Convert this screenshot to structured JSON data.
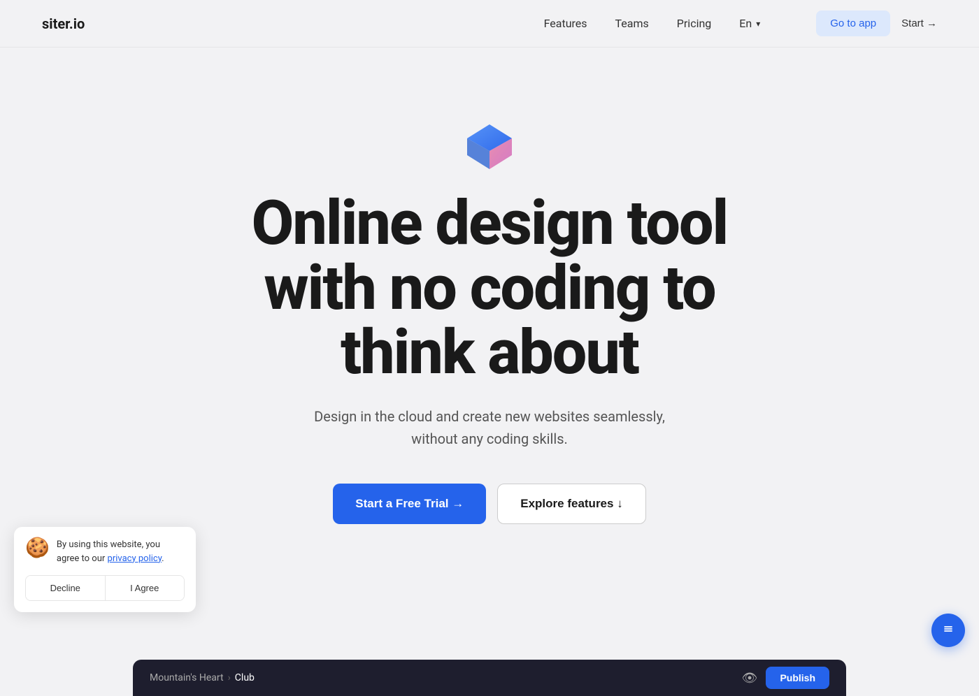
{
  "nav": {
    "logo": "siter.io",
    "links": [
      {
        "label": "Features",
        "id": "features"
      },
      {
        "label": "Teams",
        "id": "teams"
      },
      {
        "label": "Pricing",
        "id": "pricing"
      }
    ],
    "lang": "En",
    "go_to_app": "Go to app",
    "start": "Start →"
  },
  "hero": {
    "title_line1": "Online design tool",
    "title_line2": "with no coding to",
    "title_line3": "think about",
    "subtitle_line1": "Design in the cloud and create new websites seamlessly,",
    "subtitle_line2": "without any coding skills.",
    "cta_primary": "Start a Free Trial →",
    "cta_secondary": "Explore features ↓"
  },
  "cookie": {
    "icon": "🍪",
    "text": "By using this website, you agree to our ",
    "link_text": "privacy policy",
    "link_end": ".",
    "decline": "Decline",
    "agree": "I Agree"
  },
  "bottom_bar": {
    "crumb1": "Mountain's Heart",
    "separator": "›",
    "crumb2": "Club",
    "publish": "Publish"
  },
  "floating": {
    "icon": "≡"
  },
  "colors": {
    "accent": "#2563eb",
    "nav_bg": "#f2f2f4",
    "body_bg": "#f2f2f4",
    "bar_bg": "#1e1e2e"
  }
}
